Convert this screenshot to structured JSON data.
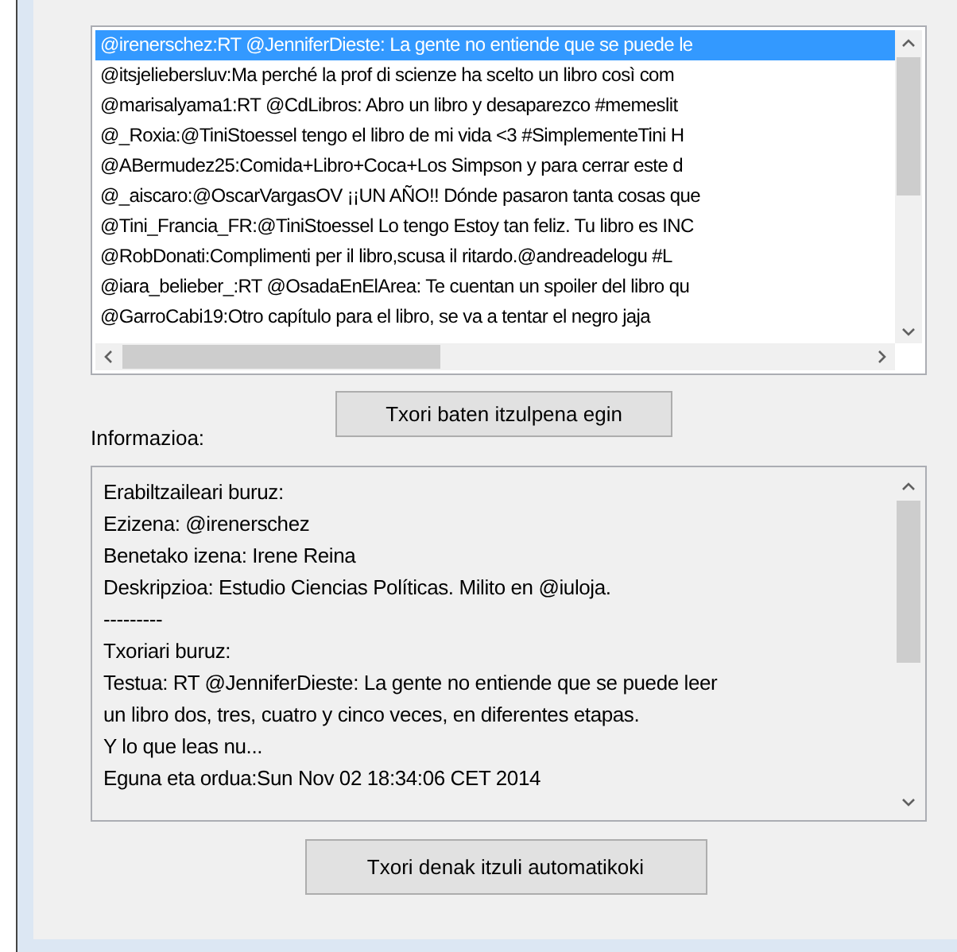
{
  "tweets": [
    {
      "text": "@irenerschez:RT @JenniferDieste: La gente no entiende que se puede le",
      "selected": true
    },
    {
      "text": "@itsjeliebersluv:Ma perché la prof di scienze ha scelto un libro così com",
      "selected": false
    },
    {
      "text": "@marisalyama1:RT @CdLibros: Abro un libro y desaparezco #memeslit",
      "selected": false
    },
    {
      "text": "@_Roxia:@TiniStoessel tengo el libro de mi vida <3 #SimplementeTini H",
      "selected": false
    },
    {
      "text": "@ABermudez25:Comida+Libro+Coca+Los Simpson y para cerrar este d",
      "selected": false
    },
    {
      "text": "@_aiscaro:@OscarVargasOV ¡¡UN AÑO!! Dónde pasaron tanta cosas que",
      "selected": false
    },
    {
      "text": "@Tini_Francia_FR:@TiniStoessel Lo tengo Estoy tan feliz. Tu libro es INC",
      "selected": false
    },
    {
      "text": "@RobDonati:Complimenti per il libro,scusa il ritardo.@andreadelogu #L",
      "selected": false
    },
    {
      "text": "@iara_belieber_:RT @OsadaEnElArea: Te cuentan un spoiler del libro qu",
      "selected": false
    },
    {
      "text": "@GarroCabi19:Otro capítulo para el libro, se va a tentar el negro jaja",
      "selected": false
    }
  ],
  "translate_button": "Txori baten itzulpena egin",
  "info_label": "Informazioa:",
  "info_lines": [
    "Erabiltzaileari buruz:",
    "Ezizena: @irenerschez",
    "Benetako izena: Irene Reina",
    "Deskripzioa: Estudio Ciencias Políticas. Milito en @iuloja.",
    "---------",
    "Txoriari buruz:",
    "Testua: RT @JenniferDieste: La gente no entiende que se puede leer",
    "un libro dos, tres, cuatro y cinco veces, en diferentes etapas.",
    "Y lo que leas nu...",
    "Eguna eta ordua:Sun Nov 02 18:34:06 CET 2014"
  ],
  "auto_translate_button": "Txori denak itzuli automatikoki"
}
